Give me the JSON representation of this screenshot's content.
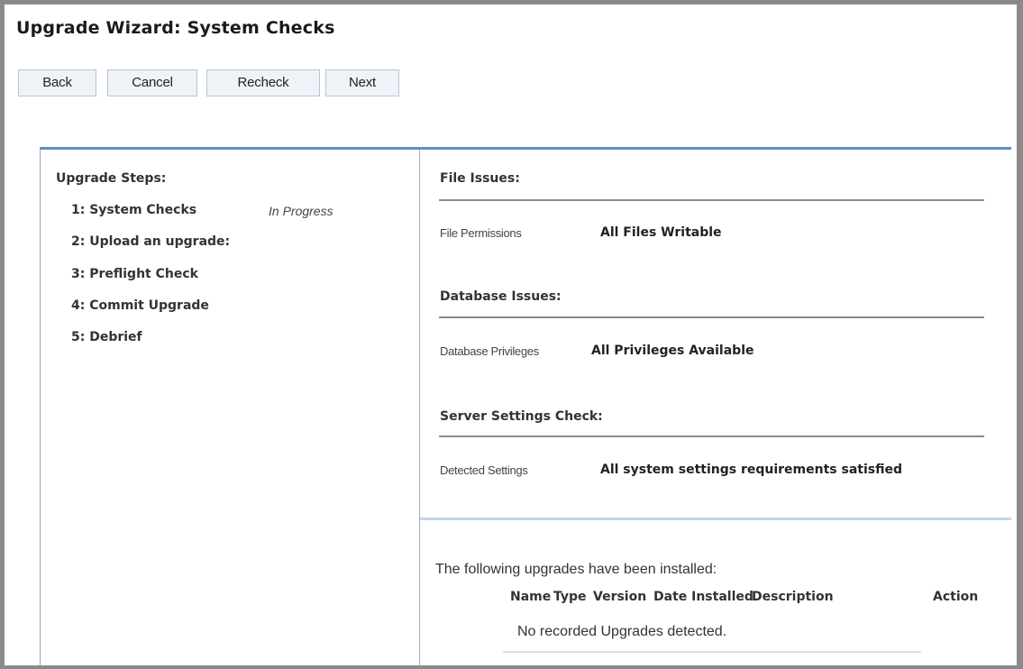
{
  "title": "Upgrade Wizard: System Checks",
  "toolbar": {
    "back": "Back",
    "cancel": "Cancel",
    "recheck": "Recheck",
    "next": "Next"
  },
  "steps": {
    "heading": "Upgrade Steps:",
    "items": [
      {
        "label": "1: System Checks",
        "status": "In Progress"
      },
      {
        "label": "2: Upload an upgrade:"
      },
      {
        "label": "3: Preflight Check"
      },
      {
        "label": "4: Commit Upgrade"
      },
      {
        "label": "5: Debrief"
      }
    ]
  },
  "checks": {
    "file": {
      "heading": "File Issues:",
      "label": "File Permissions",
      "value": "All Files Writable"
    },
    "database": {
      "heading": "Database Issues:",
      "label": "Database Privileges",
      "value": "All Privileges Available"
    },
    "server": {
      "heading": "Server Settings Check:",
      "label": "Detected Settings",
      "value": "All system settings requirements satisfied"
    }
  },
  "installed": {
    "intro": "The following upgrades have been installed:",
    "columns": [
      "Name",
      "Type",
      "Version",
      "Date Installed",
      "Description",
      "Action"
    ],
    "empty_message": "No recorded Upgrades detected."
  }
}
